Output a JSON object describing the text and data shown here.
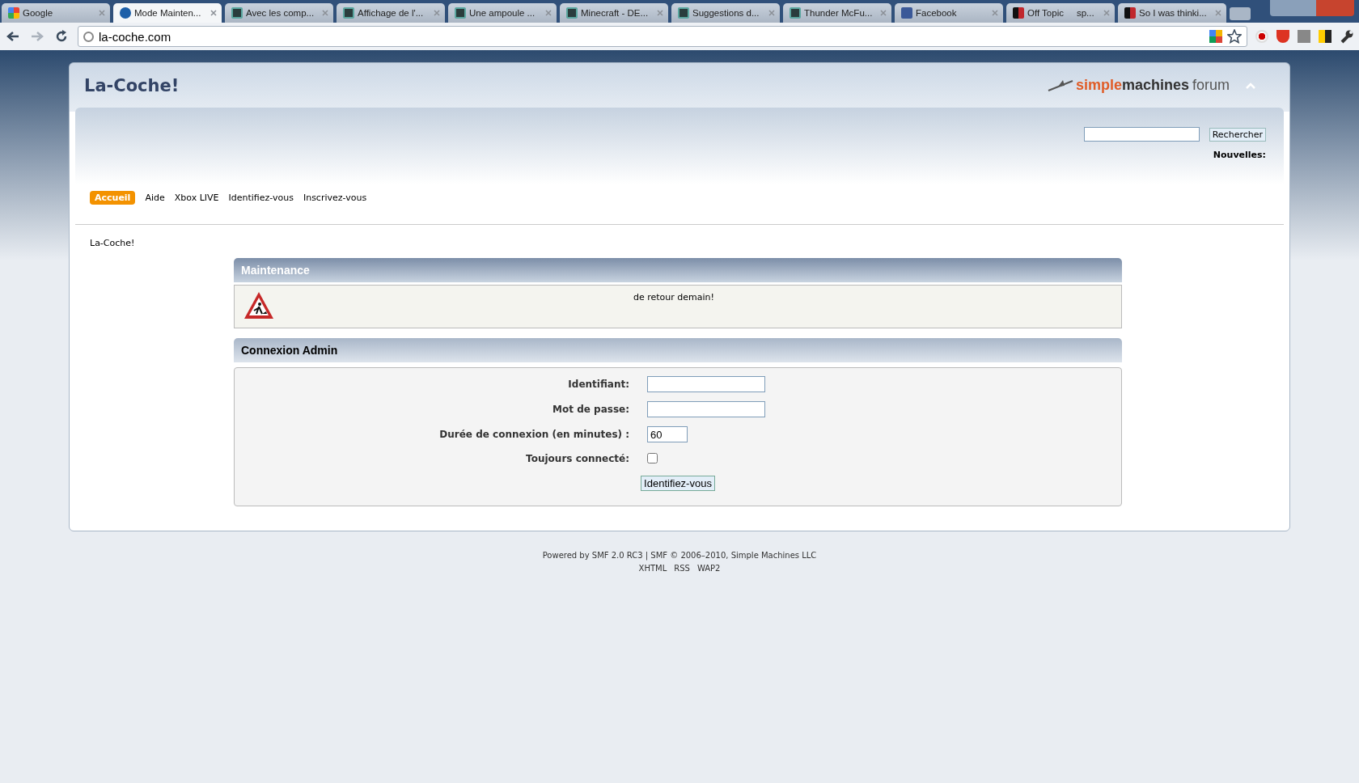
{
  "browser": {
    "tabs": [
      {
        "title": "Google",
        "kind": "google",
        "selected": false
      },
      {
        "title": "Mode Mainten...",
        "kind": "smf",
        "selected": true
      },
      {
        "title": "Avec les comp...",
        "kind": "letter",
        "selected": false
      },
      {
        "title": "Affichage de l'...",
        "kind": "letter",
        "selected": false
      },
      {
        "title": "Une ampoule ...",
        "kind": "letter",
        "selected": false
      },
      {
        "title": "Minecraft - DE...",
        "kind": "letter",
        "selected": false
      },
      {
        "title": "Suggestions d...",
        "kind": "letter",
        "selected": false
      },
      {
        "title": "Thunder McFu...",
        "kind": "letter",
        "selected": false
      },
      {
        "title": "Facebook",
        "kind": "facebook",
        "selected": false
      },
      {
        "title": "Off Topic     sp...",
        "kind": "mr",
        "selected": false
      },
      {
        "title": "So I was thinki...",
        "kind": "mr",
        "selected": false
      }
    ],
    "address": "la-coche.com"
  },
  "forum": {
    "title": "La-Coche!",
    "logo": {
      "accent": "simple",
      "main": "machines",
      "suffix": "forum"
    },
    "search": {
      "button": "Rechercher"
    },
    "news_label": "Nouvelles:",
    "menu": [
      {
        "label": "Accueil",
        "selected": true
      },
      {
        "label": "Aide",
        "selected": false
      },
      {
        "label": "Xbox LIVE",
        "selected": false
      },
      {
        "label": "Identifiez-vous",
        "selected": false
      },
      {
        "label": "Inscrivez-vous",
        "selected": false
      }
    ],
    "breadcrumb": "La-Coche!",
    "maintenance": {
      "title": "Maintenance",
      "message": "de retour demain!"
    },
    "login": {
      "title": "Connexion Admin",
      "fields": [
        {
          "kind": "text",
          "label": "Identifiant:"
        },
        {
          "kind": "password",
          "label": "Mot de passe:"
        },
        {
          "kind": "short",
          "label": "Durée de connexion (en minutes) :",
          "value": "60"
        },
        {
          "kind": "checkbox",
          "label": "Toujours connecté:",
          "checked": false
        }
      ],
      "submit": "Identifiez-vous"
    }
  },
  "footer": {
    "powered": "Powered by SMF 2.0 RC3 | SMF © 2006–2010, Simple Machines LLC",
    "links": [
      "XHTML",
      "RSS",
      "WAP2"
    ]
  }
}
